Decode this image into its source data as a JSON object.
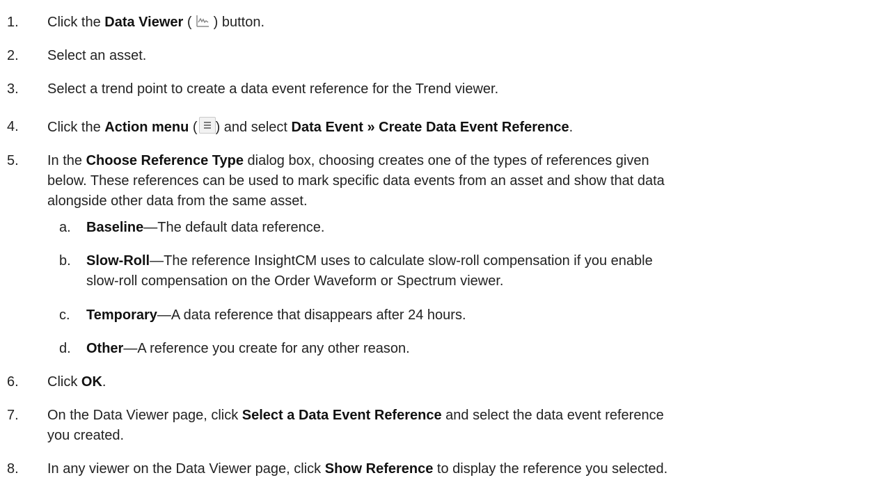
{
  "steps": [
    {
      "num": "1.",
      "pre": "Click the ",
      "bold": "Data Viewer",
      "mid": " (",
      "icon": "trend-chart-icon",
      "post": " ) button."
    },
    {
      "num": "2.",
      "text": "Select an asset."
    },
    {
      "num": "3.",
      "text": "Select a trend point to create a data event reference for the Trend viewer."
    },
    {
      "num": "4.",
      "pre": "Click the ",
      "bold": "Action menu",
      "mid": " (",
      "icon": "hamburger-menu-icon",
      "post": ") and select ",
      "bold2": "Data Event » Create Data Event Reference",
      "end": "."
    },
    {
      "num": "5.",
      "pre": "In the ",
      "bold": "Choose Reference Type",
      "post": " dialog box, choosing creates one of the types of references given",
      "line2": "below. These references can be used to mark specific data events from an asset and show that data",
      "line3": "alongside other data from the same asset."
    },
    {
      "num": "6.",
      "pre": "Click ",
      "bold": "OK",
      "end": "."
    },
    {
      "num": "7.",
      "pre": "On the Data Viewer page, click ",
      "bold": "Select a Data Event Reference",
      "post": " and select the data event reference",
      "line2": "you created."
    },
    {
      "num": "8.",
      "pre": "In any viewer on the Data Viewer page, click ",
      "bold": "Show Reference",
      "post": " to display the reference you selected."
    }
  ],
  "substeps": [
    {
      "letter": "a.",
      "bold": "Baseline",
      "text": "—The default data reference."
    },
    {
      "letter": "b.",
      "bold": "Slow-Roll",
      "text": "—The reference InsightCM uses to calculate slow-roll compensation if you enable",
      "line2": "slow-roll compensation on the Order Waveform or Spectrum viewer."
    },
    {
      "letter": "c.",
      "bold": "Temporary",
      "text": "—A data reference that disappears after 24 hours."
    },
    {
      "letter": "d.",
      "bold": "Other",
      "text": "—A reference you create for any other reason."
    }
  ],
  "colors": {
    "text": "#222222",
    "icon_gray": "#7a7a7a",
    "icon_bg": "#f2f2f2"
  }
}
